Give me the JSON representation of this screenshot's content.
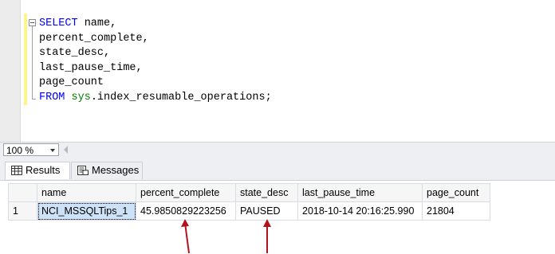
{
  "editor": {
    "lines": [
      {
        "kw": "SELECT",
        "rest": " name,",
        "obj": "",
        "tail": ""
      },
      {
        "kw": "",
        "rest": "percent_complete,",
        "obj": "",
        "tail": ""
      },
      {
        "kw": "",
        "rest": "state_desc,",
        "obj": "",
        "tail": ""
      },
      {
        "kw": "",
        "rest": "last_pause_time,",
        "obj": "",
        "tail": ""
      },
      {
        "kw": "",
        "rest": "page_count",
        "obj": "",
        "tail": ""
      },
      {
        "kw": "FROM",
        "rest": " ",
        "obj": "sys",
        "tail": ".index_resumable_operations;"
      }
    ]
  },
  "zoom": {
    "value": "100 %"
  },
  "tabs": {
    "results_label": "Results",
    "messages_label": "Messages"
  },
  "grid": {
    "columns": [
      "name",
      "percent_complete",
      "state_desc",
      "last_pause_time",
      "page_count"
    ],
    "rows": [
      {
        "num": "1",
        "cells": [
          "NCI_MSSQLTips_1",
          "45.9850829223256",
          "PAUSED",
          "2018-10-14 20:16:25.990",
          "21804"
        ]
      }
    ]
  },
  "colors": {
    "keyword": "#0000ff",
    "system_object": "#008000",
    "annotation_arrow": "#b0141c",
    "selection": "#cde2f7"
  }
}
